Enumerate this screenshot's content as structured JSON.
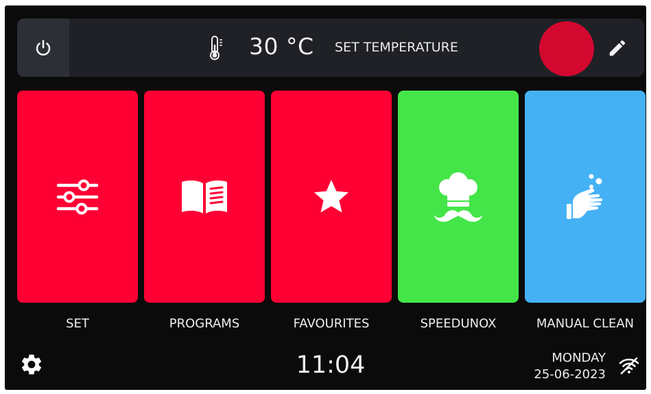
{
  "header": {
    "power_icon": "power-icon",
    "thermometer_icon": "thermometer-icon",
    "temperature": "30 °C",
    "temperature_label": "SET TEMPERATURE",
    "indicator_color": "#d3082f",
    "edit_icon": "pencil-icon"
  },
  "tiles": [
    {
      "label": "SET",
      "icon": "sliders-icon",
      "color": "#fe0034"
    },
    {
      "label": "PROGRAMS",
      "icon": "book-icon",
      "color": "#fe0034"
    },
    {
      "label": "FAVOURITES",
      "icon": "star-icon",
      "color": "#fe0034"
    },
    {
      "label": "SPEEDUNOX",
      "icon": "chef-hat-mustache-icon",
      "color": "#44e548"
    },
    {
      "label": "MANUAL CLEAN",
      "icon": "washing-hand-icon",
      "color": "#45b1f5"
    }
  ],
  "footer": {
    "settings_icon": "gear-icon",
    "time": "11:04",
    "day": "MONDAY",
    "date": "25-06-2023",
    "wifi_icon": "wifi-off-icon"
  }
}
